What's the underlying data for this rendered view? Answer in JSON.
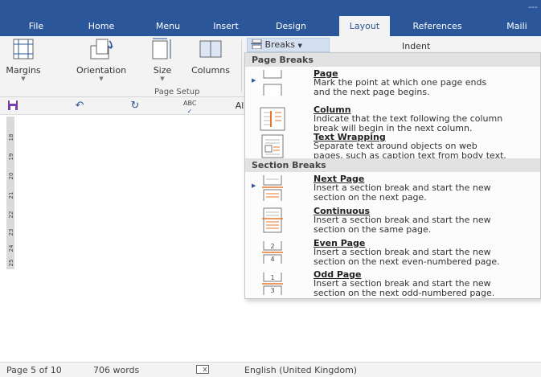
{
  "ribbon_tabs": [
    {
      "label": "File"
    },
    {
      "label": "Home"
    },
    {
      "label": "Menu"
    },
    {
      "label": "Insert"
    },
    {
      "label": "Design"
    },
    {
      "label": "Layout"
    },
    {
      "label": "References"
    },
    {
      "label": "Maili"
    }
  ],
  "ribbon": {
    "margins_label": "Margins",
    "orientation_label": "Orientation",
    "size_label": "Size",
    "columns_label": "Columns",
    "group_label": "Page Setup",
    "breaks_label": "Breaks",
    "indent_label": "Indent"
  },
  "qat": {
    "partial_label": "Al"
  },
  "ruler": {
    "numbers": [
      "18",
      "19",
      "20",
      "21",
      "22",
      "23",
      "24",
      "25"
    ]
  },
  "breaks_menu": {
    "page_breaks_header": "Page Breaks",
    "section_breaks_header": "Section Breaks",
    "items": [
      {
        "title": "Page",
        "desc_line1": "Mark the point at which one page ends",
        "desc_line2": "and the next page begins."
      },
      {
        "title": "Column",
        "desc_line1": "Indicate that the text following the column",
        "desc_line2": "break will begin in the next column."
      },
      {
        "title": "Text Wrapping",
        "desc_line1": "Separate text around objects on web",
        "desc_line2": "pages, such as caption text from body text."
      },
      {
        "title": "Next Page",
        "desc_line1": "Insert a section break and start the new",
        "desc_line2": "section on the next page."
      },
      {
        "title": "Continuous",
        "desc_line1": "Insert a section break and start the new",
        "desc_line2": "section on the same page."
      },
      {
        "title": "Even Page",
        "desc_line1": "Insert a section break and start the new",
        "desc_line2": "section on the next even-numbered page."
      },
      {
        "title": "Odd Page",
        "desc_line1": "Insert a section break and start the new",
        "desc_line2": "section on the next odd-numbered page."
      }
    ]
  },
  "status_bar": {
    "page": "Page 5 of 10",
    "words": "706 words",
    "language": "English (United Kingdom)"
  },
  "colors": {
    "accent": "#2b579a",
    "ribbon_bg": "#f3f3f3",
    "menu_header_bg": "#e2e2e2",
    "breaks_button_bg": "#d5e1f2",
    "break_icon_orange": "#e8782b"
  },
  "icons": {
    "qat_icons": [
      "save-icon",
      "undo-icon",
      "redo-icon",
      "spelling-icon"
    ],
    "status_icon": "proofing-icon"
  }
}
